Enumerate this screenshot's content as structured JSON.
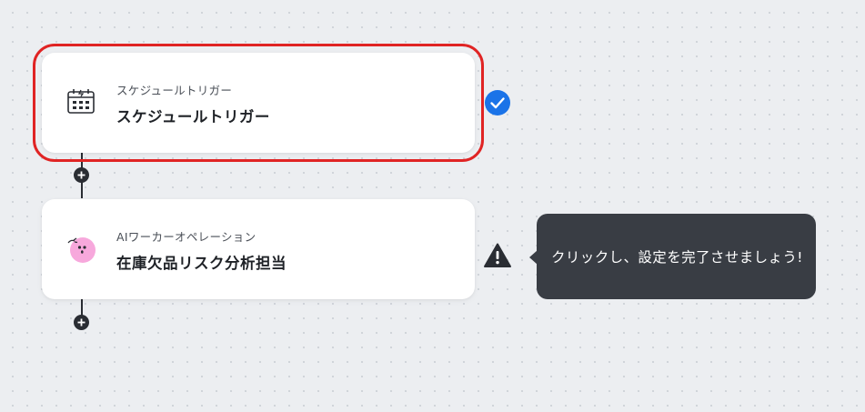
{
  "colors": {
    "canvas_bg": "#eceef1",
    "card_bg": "#ffffff",
    "selection_outline": "#e02424",
    "success": "#1a73e8",
    "warning": "#2a2d33",
    "tooltip_bg": "#393d44",
    "ai_worker_icon_bg": "#f7a8dc"
  },
  "flow": {
    "steps": [
      {
        "subtitle": "スケジュールトリガー",
        "title": "スケジュールトリガー",
        "icon": "calendar-clock-icon",
        "status": "completed",
        "status_icon": "check-circle-icon",
        "selected": true
      },
      {
        "subtitle": "AIワーカーオペレーション",
        "title": "在庫欠品リスク分析担当",
        "icon": "ai-worker-avatar-icon",
        "status": "warning",
        "status_icon": "warning-triangle-icon",
        "selected": false
      }
    ],
    "add_step_icon": "plus-icon"
  },
  "tooltip": {
    "text": "クリックし、設定を完了させましょう!"
  }
}
